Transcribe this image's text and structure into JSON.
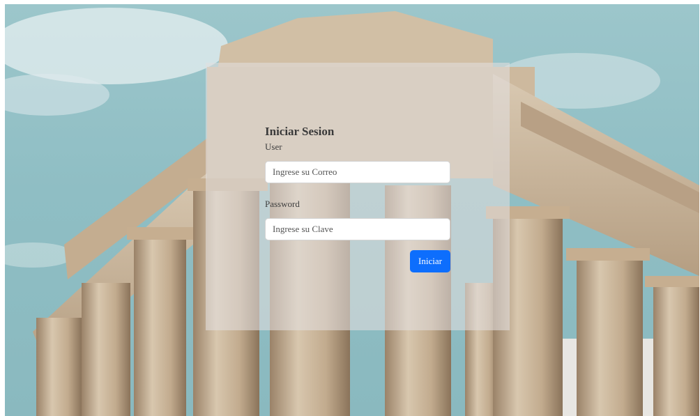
{
  "login": {
    "title": "Iniciar Sesion",
    "user_label": "User",
    "user_placeholder": "Ingrese su Correo",
    "password_label": "Password",
    "password_placeholder": "Ingrese su Clave",
    "submit_label": "Iniciar"
  },
  "colors": {
    "sky": "#8fbec4",
    "stone": "#c9b59c",
    "panel": "#e1dede",
    "button": "#0d6efd",
    "button_text": "#ffffff"
  },
  "background": {
    "subject": "ancient-greek-temple-columns-photo"
  }
}
